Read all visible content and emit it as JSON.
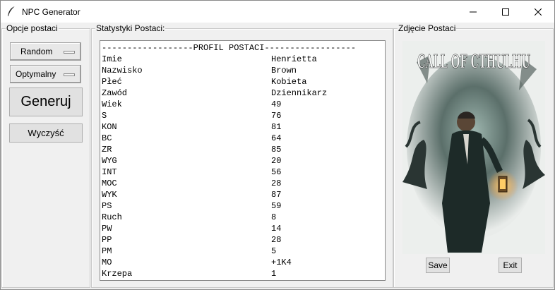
{
  "window": {
    "title": "NPC Generator"
  },
  "options_panel": {
    "label": "Opcje postaci",
    "mode_select": "Random",
    "method_select": "Optymalny",
    "generate_button": "Generuj",
    "clear_button": "Wyczyść"
  },
  "stats_panel": {
    "label": "Statystyki Postaci:",
    "header_line": "------------------PROFIL POSTACI------------------",
    "rows": [
      {
        "k": "Imie",
        "v": "Henrietta"
      },
      {
        "k": "Nazwisko",
        "v": "Brown"
      },
      {
        "k": "Płeć",
        "v": "Kobieta"
      },
      {
        "k": "Zawód",
        "v": "Dziennikarz"
      },
      {
        "k": "Wiek",
        "v": "49"
      },
      {
        "k": "S",
        "v": "76"
      },
      {
        "k": "KON",
        "v": "81"
      },
      {
        "k": "BC",
        "v": "64"
      },
      {
        "k": "ZR",
        "v": "85"
      },
      {
        "k": "WYG",
        "v": "20"
      },
      {
        "k": "INT",
        "v": "56"
      },
      {
        "k": "MOC",
        "v": "28"
      },
      {
        "k": "WYK",
        "v": "87"
      },
      {
        "k": "PS",
        "v": "59"
      },
      {
        "k": "Ruch",
        "v": "8"
      },
      {
        "k": "PW",
        "v": "14"
      },
      {
        "k": "PP",
        "v": "28"
      },
      {
        "k": "PM",
        "v": "5"
      },
      {
        "k": "MO",
        "v": "+1K4"
      },
      {
        "k": "Krzepa",
        "v": "1"
      }
    ]
  },
  "photo_panel": {
    "label": "Zdjęcie Postaci",
    "cover_logo": "CALL OF CTHULHU",
    "save_button": "Save",
    "exit_button": "Exit"
  },
  "icons": {
    "app": "feather-icon",
    "minimize": "minimize-icon",
    "maximize": "maximize-icon",
    "close": "close-icon"
  }
}
